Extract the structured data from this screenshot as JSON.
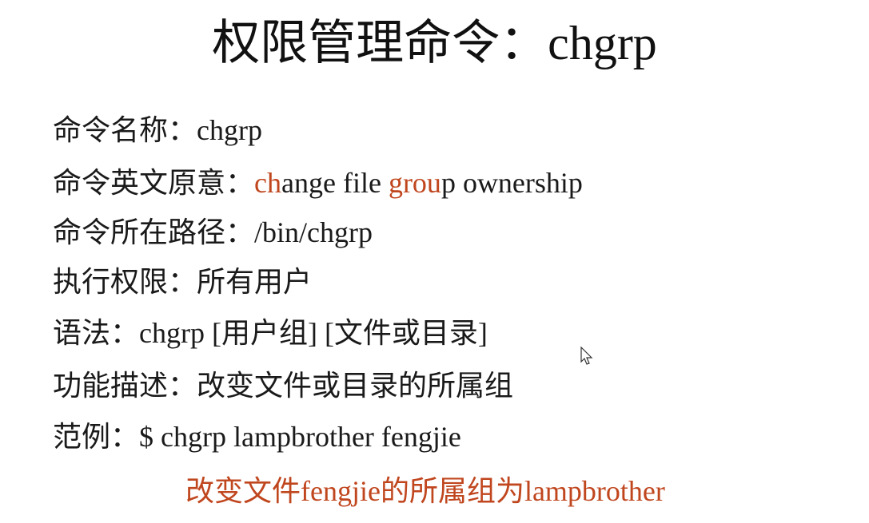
{
  "title": "权限管理命令：chgrp",
  "lines": {
    "name": "命令名称：chgrp",
    "origin_prefix": "命令英文原意：",
    "origin_parts": [
      "ch",
      "ange file ",
      "grou",
      "p",
      " ownership"
    ],
    "path": "命令所在路径：/bin/chgrp",
    "permission": "执行权限：所有用户",
    "syntax": "语法：chgrp  [用户组]  [文件或目录]",
    "description": "功能描述：改变文件或目录的所属组",
    "example": "范例：$ chgrp lampbrother fengjie"
  },
  "note": "改变文件fengjie的所属组为lampbrother",
  "colors": {
    "highlight": "#c0461e",
    "text": "#1a1a1a"
  },
  "icons": {
    "cursor": "mouse-pointer-icon"
  }
}
